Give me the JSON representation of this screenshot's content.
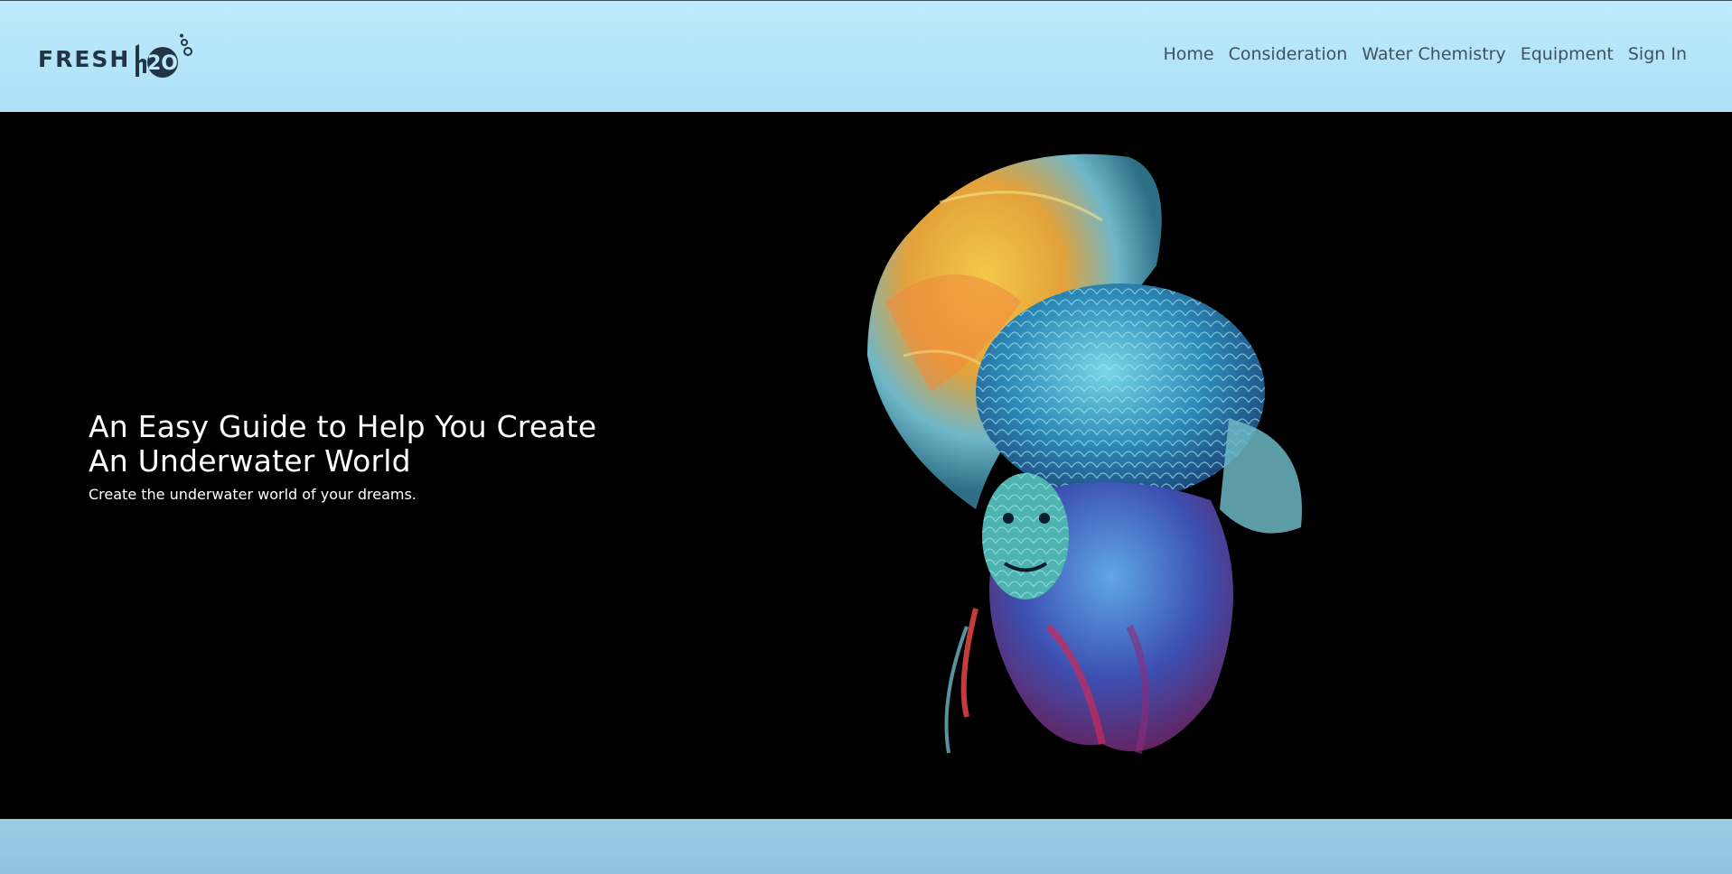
{
  "brand": {
    "word": "FRESH",
    "mark_text": "h2O"
  },
  "nav": {
    "items": [
      "Home",
      "Consideration",
      "Water Chemistry",
      "Equipment",
      "Sign In"
    ]
  },
  "hero": {
    "title_line1": "An Easy Guide to Help You Create",
    "title_line2": "An Underwater World",
    "subtitle": "Create the underwater world of your dreams.",
    "image": "betta-fish-photo"
  },
  "colors": {
    "header_bg": "#b6e6fa",
    "hero_bg": "#000000",
    "footer_bg": "#94c4e2",
    "nav_text": "#40525f",
    "logo_text": "#233544"
  }
}
